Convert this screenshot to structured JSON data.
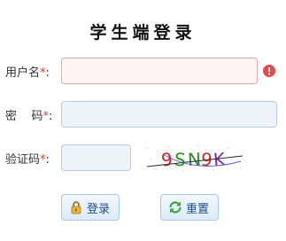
{
  "title": "学生端登录",
  "form": {
    "username": {
      "label": "用户名",
      "required_mark": "*",
      "colon": ":",
      "value": ""
    },
    "password": {
      "label": "密    码",
      "required_mark": "*",
      "colon": ":",
      "value": ""
    },
    "captcha": {
      "label": "验证码",
      "required_mark": "*",
      "colon": ":",
      "value": "",
      "image_text": "9SN9K"
    }
  },
  "buttons": {
    "login": "登录",
    "reset": "重置"
  },
  "icons": {
    "error": "error-circle-icon",
    "login": "lock-icon",
    "reset": "refresh-icon"
  },
  "colors": {
    "required": "#e53935",
    "error": "#e84b4b",
    "button_text": "#1d4f8a"
  }
}
